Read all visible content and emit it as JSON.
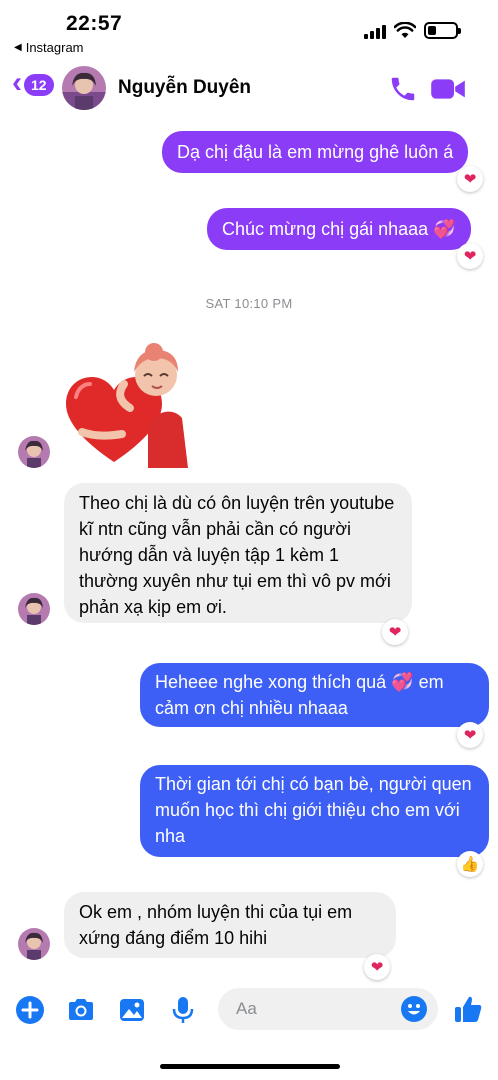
{
  "status_bar": {
    "time": "22:57",
    "back_app": "Instagram"
  },
  "header": {
    "back_count": "12",
    "contact_name": "Nguyễn Duyên"
  },
  "messages": [
    {
      "text": "Dạ chị đậu là em mừng ghê luôn á",
      "reaction": "❤"
    },
    {
      "text": "Chúc mừng chị gái nhaaa 💞",
      "reaction": "❤"
    },
    {
      "text": "Theo chị là dù có ôn luyện trên youtube kĩ ntn cũng vẫn phải cần có người hướng dẫn và luyện tập 1 kèm 1 thường xuyên như tụi em thì vô pv mới phản xạ kịp em ơi.",
      "reaction": "❤"
    },
    {
      "text": "Heheee nghe xong thích quá 💞 em cảm ơn chị nhiều nhaaa",
      "reaction": "❤"
    },
    {
      "text": "Thời gian tới chị có bạn bè, người quen muốn học thì chị giới thiệu cho em với nha",
      "reaction": "👍"
    },
    {
      "text": "Ok em , nhóm luyện thi của tụi em xứng đáng điểm 10 hihi",
      "reaction": "❤"
    }
  ],
  "timestamp": "SAT 10:10 PM",
  "composer": {
    "placeholder": "Aa"
  },
  "icons": {
    "call": "phone-icon",
    "video": "video-camera-icon",
    "plus": "plus-icon",
    "camera": "camera-icon",
    "gallery": "image-icon",
    "mic": "microphone-icon",
    "emoji": "emoji-icon",
    "like": "thumbs-up-icon"
  },
  "colors": {
    "accent": "#8b3cf6",
    "blue_bubble": "#3e5ff5",
    "incoming_bubble": "#efefef",
    "composer_blue": "#1877f2"
  }
}
